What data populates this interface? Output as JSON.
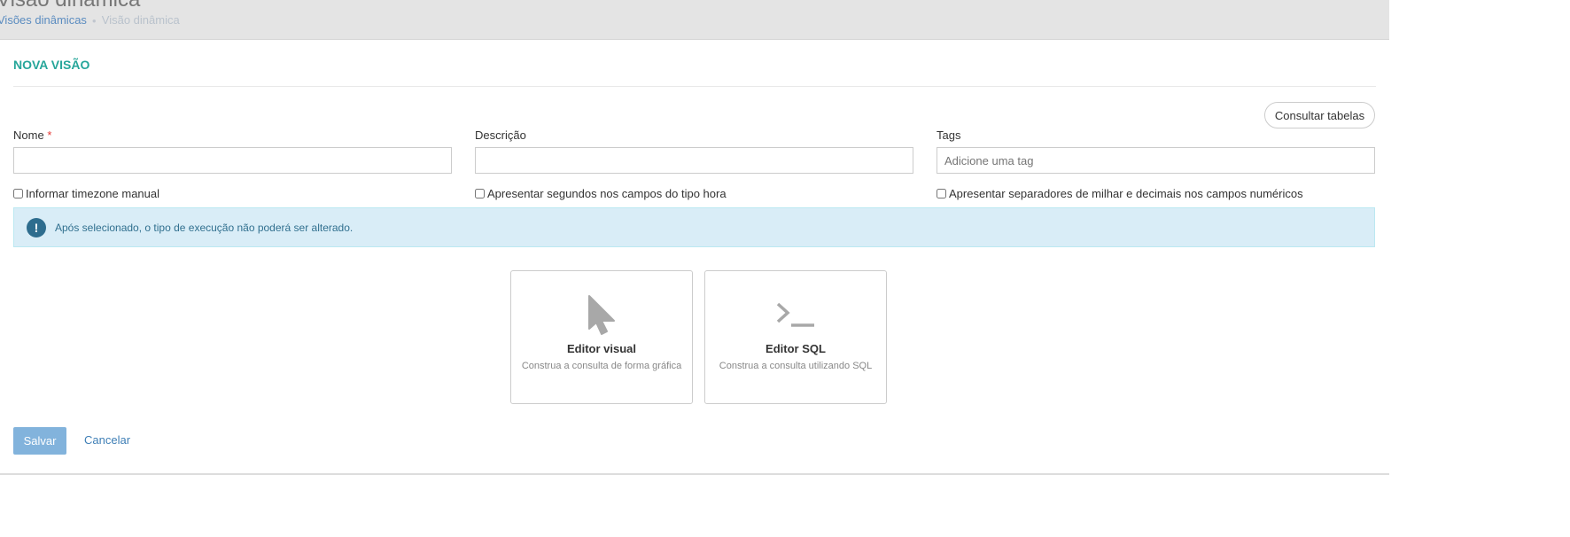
{
  "header": {
    "title": "Visão dinâmica",
    "breadcrumb": [
      {
        "label": "Visões dinâmicas"
      },
      {
        "label": "Visão dinâmica"
      }
    ]
  },
  "form": {
    "title": "NOVA VISÃO",
    "consult_button": "Consultar tabelas",
    "name_label": "Nome",
    "required_mark": "*",
    "description_label": "Descrição",
    "tags_label": "Tags",
    "tags_placeholder": "Adicione uma tag",
    "name_value": "",
    "description_value": "",
    "checkboxes": [
      {
        "label": "Informar timezone manual",
        "checked": false
      },
      {
        "label": "Apresentar segundos nos campos do tipo hora",
        "checked": false
      },
      {
        "label": "Apresentar separadores de milhar e decimais nos campos numéricos",
        "checked": false
      }
    ],
    "alert": {
      "icon": "!",
      "text": "Após selecionado, o tipo de execução não poderá ser alterado."
    },
    "options": [
      {
        "title": "Editor visual",
        "desc": "Construa a consulta de forma gráfica",
        "icon": "cursor-icon"
      },
      {
        "title": "Editor SQL",
        "desc": "Construa a consulta utilizando SQL",
        "icon": "terminal-icon"
      }
    ],
    "save": "Salvar",
    "cancel": "Cancelar"
  }
}
